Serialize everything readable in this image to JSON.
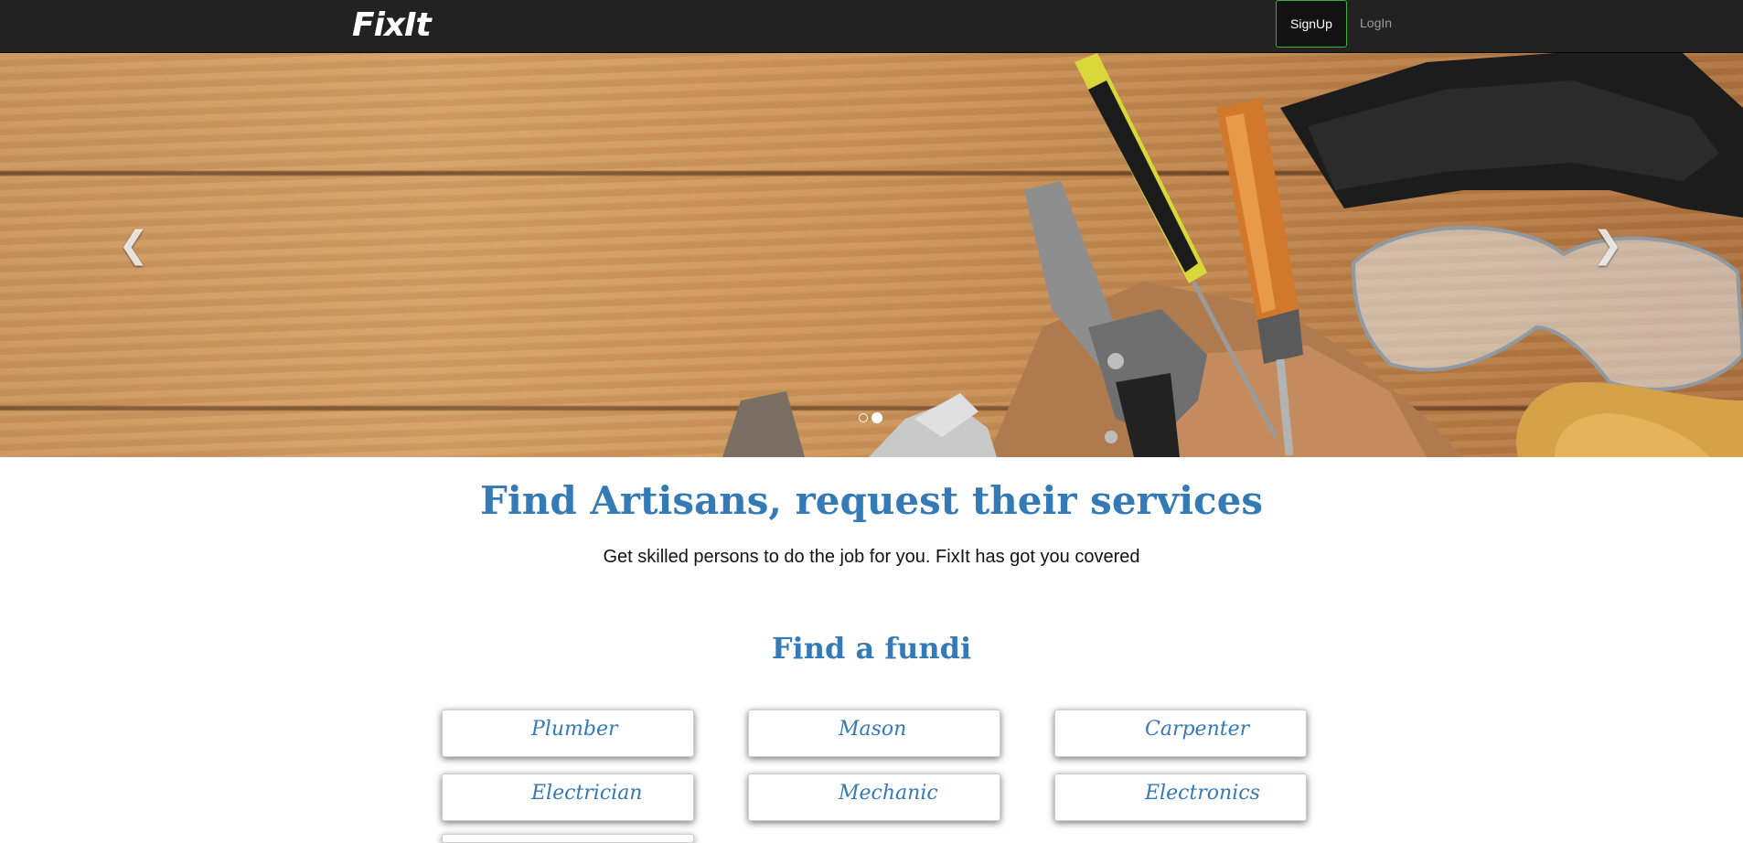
{
  "navbar": {
    "brand": "FixIt",
    "signup_label": "SignUp",
    "login_label": "LogIn",
    "accent_border": "#3fae3f"
  },
  "carousel": {
    "prev_icon": "chevron-left-icon",
    "next_icon": "chevron-right-icon",
    "slides_count": 2,
    "active_slide": 2,
    "image_description": "carpentry tools on wooden planks"
  },
  "hero": {
    "title": "Find Artisans, request their services",
    "subtitle": "Get skilled persons to do the job for you. FixIt has got you covered"
  },
  "fundi": {
    "title": "Find a fundi",
    "categories": [
      "Plumber",
      "Mason",
      "Carpenter",
      "Electrician",
      "Mechanic",
      "Electronics"
    ]
  },
  "colors": {
    "navbar_bg": "#222222",
    "accent_blue": "#337ab7",
    "text_dark": "#111111"
  }
}
